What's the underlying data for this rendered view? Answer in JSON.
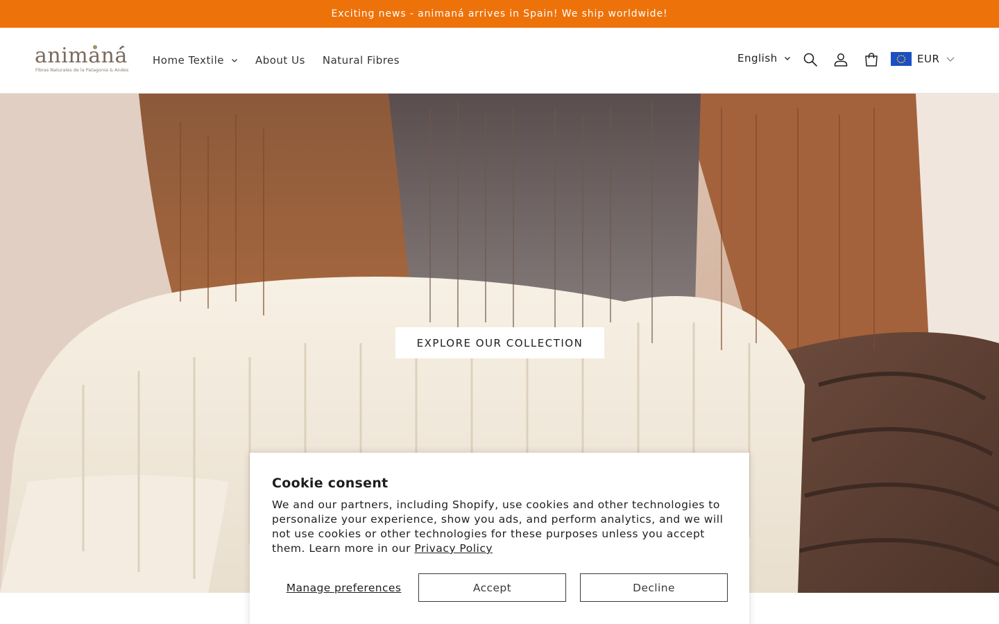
{
  "announcement": {
    "text": "Exciting news - animaná arrives in Spain! We ship worldwide!"
  },
  "brand": {
    "name": "animaná",
    "tagline": "Fibras Naturales de la Patagonia & Andes"
  },
  "nav": {
    "items": [
      {
        "label": "Home Textile",
        "has_dropdown": true
      },
      {
        "label": "About Us",
        "has_dropdown": false
      },
      {
        "label": "Natural Fibres",
        "has_dropdown": false
      }
    ]
  },
  "header_tools": {
    "language": "English",
    "currency": "EUR",
    "icons": [
      "search-icon",
      "account-icon",
      "cart-icon",
      "eu-flag-icon"
    ]
  },
  "hero": {
    "cta_label": "EXPLORE OUR COLLECTION"
  },
  "cookie": {
    "title": "Cookie consent",
    "body": "We and our partners, including Shopify, use cookies and other technologies to personalize your experience, show you ads, and perform analytics, and we will not use cookies or other technologies for these purposes unless you accept them. Learn more in our",
    "link_label": "Privacy Policy",
    "manage_label": "Manage preferences",
    "accept_label": "Accept",
    "decline_label": "Decline"
  },
  "colors": {
    "announcement_bg": "#ee720a",
    "text": "#1e1e1e",
    "flag": "#1c4fc4"
  }
}
